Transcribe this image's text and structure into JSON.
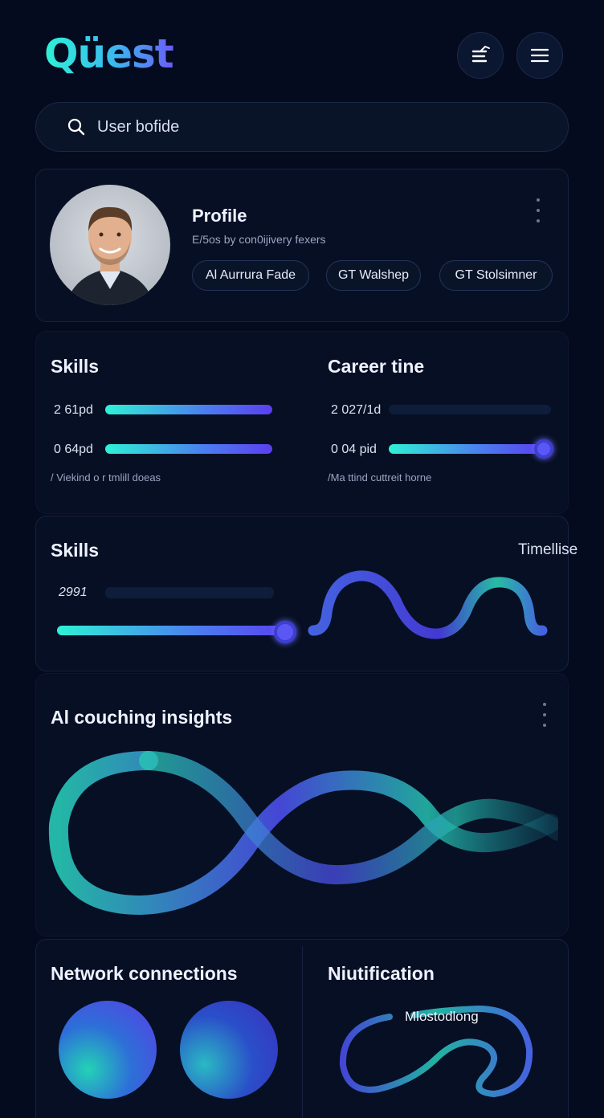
{
  "header": {
    "logo": "Qüest",
    "icons": [
      "checklist-icon",
      "menu-icon"
    ]
  },
  "search": {
    "placeholder": "User bofide"
  },
  "profile": {
    "title": "Profile",
    "subtitle": "E/5os by con0ijivery fexers",
    "chips": [
      "Al Aurrura Fade",
      "GT Walshep",
      "GT Stolsimner"
    ]
  },
  "skills_card": {
    "skills": {
      "title": "Skills",
      "rows": [
        {
          "label": "2 61pd",
          "value": 100
        },
        {
          "label": "0 64pd",
          "value": 100
        }
      ],
      "note": "/ Viekind o r tmlill doeas"
    },
    "career": {
      "title": "Career tine",
      "rows": [
        {
          "label": "2 027/1d",
          "value": 0
        },
        {
          "label": "0 04 pid",
          "value": 95
        }
      ],
      "note": "/Ma ttind cuttreit horne"
    }
  },
  "timeline_card": {
    "title": "Skills",
    "right_label": "Timellise",
    "row_label": "2991",
    "slider_value": 100
  },
  "insights": {
    "title": "Al couching insights"
  },
  "network": {
    "title": "Network connections"
  },
  "notification": {
    "title": "Niutification",
    "label": "Mlostodlong"
  },
  "colors": {
    "background": "#050b1f",
    "accent_teal": "#2ef2d6",
    "accent_blue": "#4b7df0",
    "accent_violet": "#5b3ff0"
  }
}
